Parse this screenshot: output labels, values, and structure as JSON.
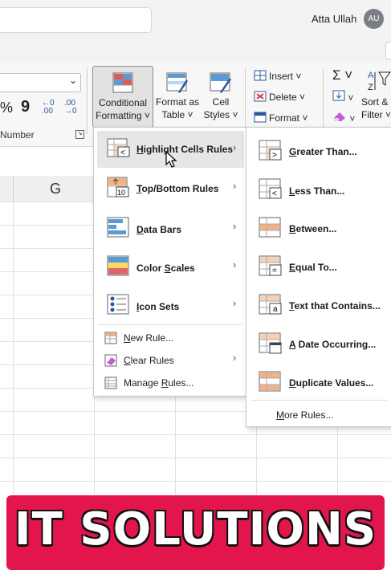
{
  "titlebar": {
    "user_name": "Atta Ullah",
    "avatar_initials": "AU"
  },
  "ribbon": {
    "number_group_label": "Number",
    "percent_symbol": "%",
    "comma_symbol": "9",
    "increase_decimal": "←0\n.00",
    "decrease_decimal": ".00\n→0",
    "conditional_formatting": [
      "Conditional",
      "Formatting ˅"
    ],
    "format_as_table": [
      "Format as",
      "Table ˅"
    ],
    "cell_styles": [
      "Cell",
      "Styles ˅"
    ],
    "insert": "Insert ˅",
    "delete": "Delete ˅",
    "format": "Format ˅",
    "sort_filter": [
      "Sort &",
      "Filter ˅"
    ],
    "autosum_symbol": "Σ ˅"
  },
  "grid": {
    "column_letter": "G"
  },
  "menu": {
    "items": [
      {
        "label": "Highlight Cells Rules",
        "submenu": true
      },
      {
        "label": "Top/Bottom Rules",
        "submenu": true
      },
      {
        "label": "Data Bars",
        "submenu": true
      },
      {
        "label": "Color Scales",
        "submenu": true
      },
      {
        "label": "Icon Sets",
        "submenu": true
      },
      {
        "label": "New Rule...",
        "submenu": false
      },
      {
        "label": "Clear Rules",
        "submenu": true
      },
      {
        "label": "Manage Rules...",
        "submenu": false
      }
    ],
    "arrow_glyph": "›"
  },
  "submenu": {
    "items": [
      {
        "label": "Greater Than..."
      },
      {
        "label": "Less Than..."
      },
      {
        "label": "Between..."
      },
      {
        "label": "Equal To..."
      },
      {
        "label": "Text that Contains..."
      },
      {
        "label": "A Date Occurring..."
      },
      {
        "label": "Duplicate Values..."
      }
    ],
    "more_rules": "More Rules..."
  },
  "banner": {
    "text": "IT SOLUTIONS",
    "color": "#e3154d"
  },
  "colors": {
    "accent": "#2b579a",
    "menu_highlight": "#e6e6e6"
  }
}
